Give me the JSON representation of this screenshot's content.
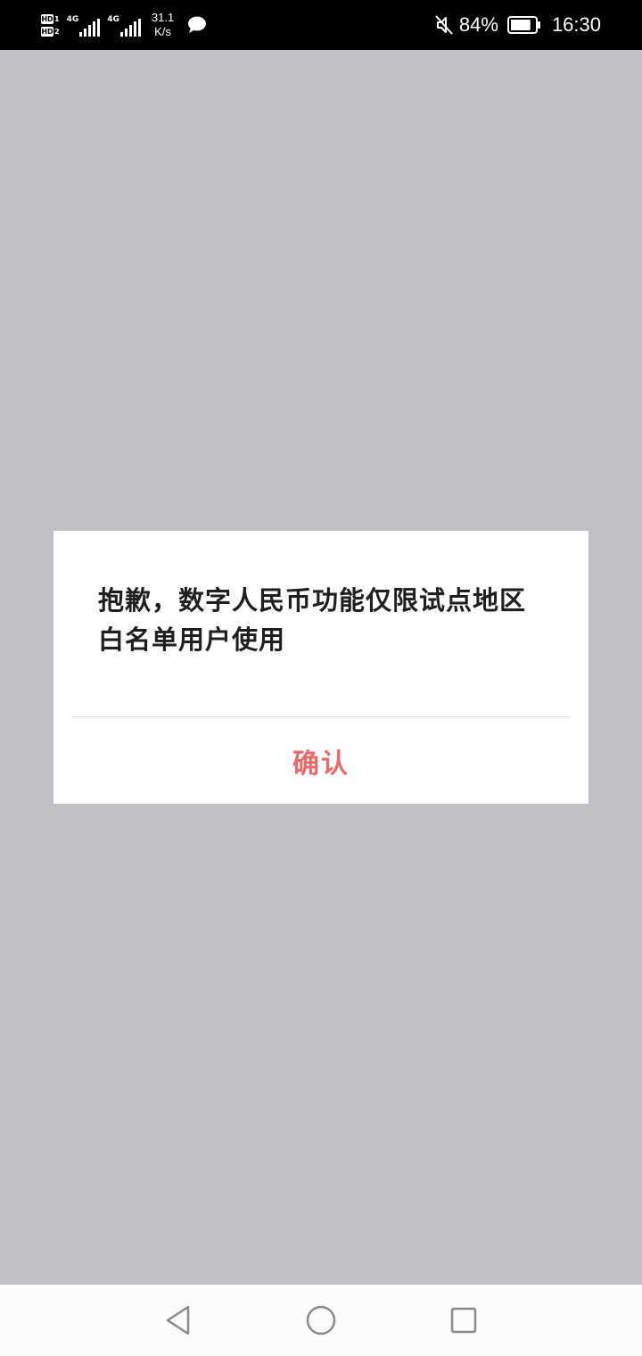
{
  "status_bar": {
    "sim1_label": "HD",
    "sim1_index": "1",
    "sim2_label": "HD",
    "sim2_index": "2",
    "signal1_label": "4G",
    "signal2_label": "4G",
    "net_speed_value": "31.1",
    "net_speed_unit": "K/s",
    "notification_icon": "chat-bubble-icon",
    "mute_icon": "mute-icon",
    "battery_percent": "84%",
    "battery_level": 0.84,
    "time": "16:30"
  },
  "dialog": {
    "message": "抱歉，数字人民币功能仅限试点地区白名单用户使用",
    "confirm_label": "确认",
    "confirm_color": "#ed6a6c"
  },
  "nav_bar": {
    "back_icon": "back-triangle-icon",
    "home_icon": "home-circle-icon",
    "recents_icon": "recents-square-icon"
  },
  "colors": {
    "overlay": "#c1c0c5",
    "status_bar": "#000000",
    "dialog_bg": "#ffffff",
    "nav_bar": "#fbfbfb"
  }
}
